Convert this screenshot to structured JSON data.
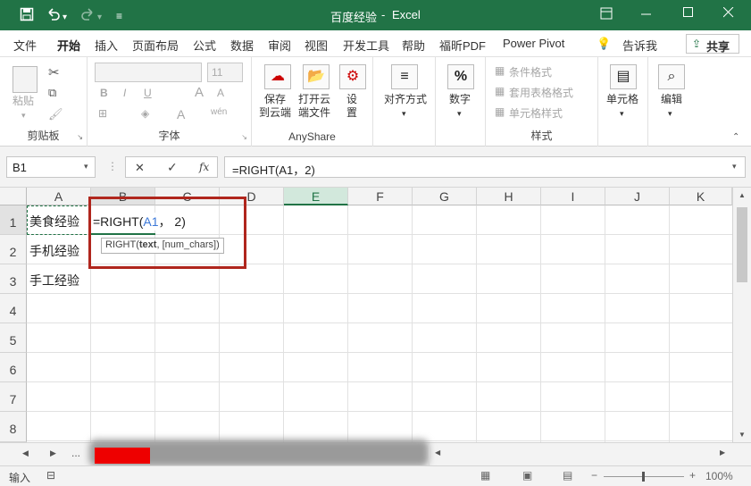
{
  "window": {
    "title": "百度经验",
    "app": "Excel",
    "separator": "-"
  },
  "qat": {
    "save": "save-icon",
    "undo": "undo-icon",
    "redo": "redo-icon"
  },
  "tabs": [
    "文件",
    "开始",
    "插入",
    "页面布局",
    "公式",
    "数据",
    "审阅",
    "视图",
    "开发工具",
    "帮助",
    "福昕PDF",
    "Power Pivot"
  ],
  "tell_me": "告诉我",
  "share": "共享",
  "ribbon": {
    "clipboard": {
      "paste": "粘贴",
      "group": "剪贴板"
    },
    "font": {
      "size": "11",
      "group": "字体",
      "bold": "B",
      "italic": "I",
      "underline": "U",
      "grow": "A",
      "shrink": "A",
      "font_color": "A",
      "phonetic": "wén"
    },
    "anyshare": {
      "save_cloud": "保存\n到云端",
      "open_cloud": "打开云\n端文件",
      "settings": "设\n置",
      "group": "AnyShare"
    },
    "alignment": {
      "label": "对齐方式"
    },
    "number": {
      "label": "数字",
      "symbol": "%"
    },
    "styles": {
      "cond": "条件格式",
      "table": "套用表格格式",
      "cell": "单元格样式",
      "group": "样式"
    },
    "cells": {
      "label": "单元格"
    },
    "editing": {
      "label": "编辑"
    }
  },
  "formula_bar": {
    "name_box": "B1",
    "cancel": "✕",
    "enter": "✓",
    "fx": "fx",
    "formula": "=RIGHT(A1，2)"
  },
  "columns": [
    "A",
    "B",
    "C",
    "D",
    "E",
    "F",
    "G",
    "H",
    "I",
    "J",
    "K"
  ],
  "selected_column": "E",
  "rows": [
    "1",
    "2",
    "3",
    "4",
    "5",
    "6",
    "7",
    "8"
  ],
  "cells": {
    "A1": "美食经验",
    "A2": "手机经验",
    "A3": "手工经验"
  },
  "edit": {
    "prefix": "=RIGHT(",
    "ref": "A1",
    "rest": "，  2)"
  },
  "tooltip": {
    "fn": "RIGHT(",
    "arg1": "text",
    "rest": ", [num_chars])"
  },
  "sheet_nav": {
    "prev": "◀",
    "next": "▶",
    "more": "..."
  },
  "status": {
    "mode": "输入",
    "zoom": "100%"
  },
  "colors": {
    "excel_green": "#217346",
    "annotation_red": "#b0261d"
  }
}
